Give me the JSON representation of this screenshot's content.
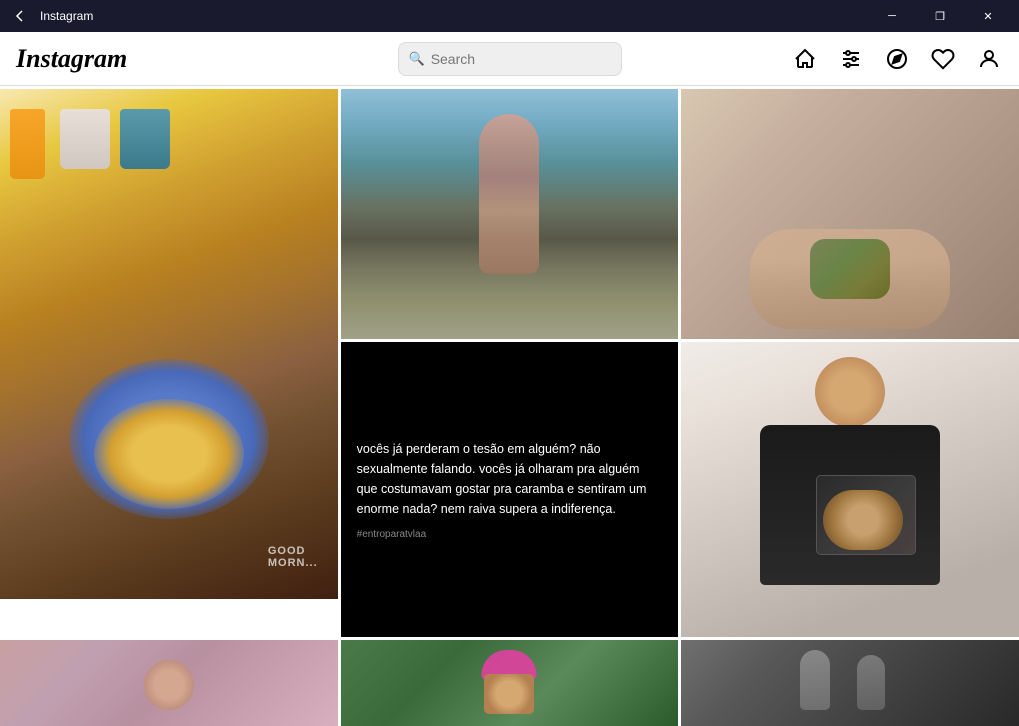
{
  "titleBar": {
    "back": "‹",
    "title": "Instagram",
    "minimize": "─",
    "maximize": "❐",
    "close": "✕"
  },
  "header": {
    "logo": "Instagram",
    "search": {
      "placeholder": "Search",
      "value": ""
    },
    "nav": {
      "home_label": "Home",
      "explore_label": "Explore",
      "compass_label": "Compass",
      "heart_label": "Likes",
      "profile_label": "Profile"
    }
  },
  "posts": [
    {
      "id": 1,
      "type": "food",
      "row": 1,
      "col": 1,
      "description": "Breakfast food photo with eggs, yogurt, juice"
    },
    {
      "id": 2,
      "type": "person",
      "row": 1,
      "col": 2,
      "description": "Woman in bikini outdoors"
    },
    {
      "id": 3,
      "type": "animal",
      "row": 1,
      "col": 3,
      "description": "Small lizard or reptile in hand"
    },
    {
      "id": 4,
      "type": "text",
      "row": 2,
      "col": 1,
      "description": "Black background text post in Portuguese",
      "text": "vocês já perderam o tesão em alguém? não sexualmente falando. vocês já olharam pra alguém que costumavam gostar pra caramba e sentiram um enorme nada? nem raiva supera a indiferença.",
      "tag": "#entroparatvlaa"
    },
    {
      "id": 5,
      "type": "athlete",
      "row": 2,
      "col": 2,
      "description": "Young man holding luxury watch box"
    },
    {
      "id": 6,
      "type": "portrait",
      "row": 3,
      "col": 1,
      "description": "Woman with glasses selfie"
    },
    {
      "id": 7,
      "type": "person_hat",
      "row": 3,
      "col": 2,
      "description": "Person with pink NY hat outdoors"
    },
    {
      "id": 8,
      "type": "couple",
      "row": 3,
      "col": 3,
      "description": "Black and white photo of two people"
    }
  ]
}
